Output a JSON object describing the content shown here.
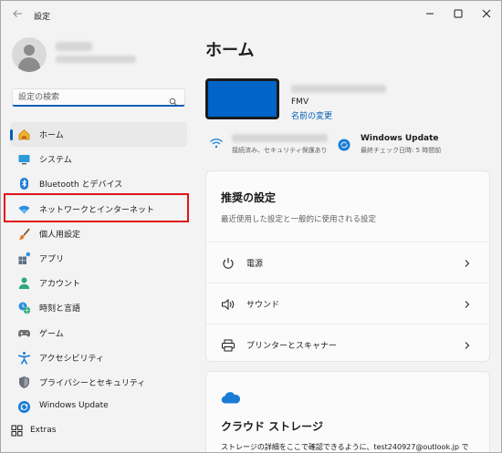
{
  "window": {
    "app_title": "設定",
    "back_icon": "back-arrow-icon",
    "controls": [
      "minimize-icon",
      "maximize-icon",
      "close-icon"
    ]
  },
  "sidebar": {
    "search": {
      "placeholder": "設定の検索",
      "value": ""
    },
    "items": [
      {
        "label": "ホーム",
        "icon": "home-icon",
        "selected": true
      },
      {
        "label": "システム",
        "icon": "system-icon"
      },
      {
        "label": "Bluetooth とデバイス",
        "icon": "bluetooth-icon"
      },
      {
        "label": "ネットワークとインターネット",
        "icon": "network-icon",
        "highlighted": true
      },
      {
        "label": "個人用設定",
        "icon": "brush-icon"
      },
      {
        "label": "アプリ",
        "icon": "apps-icon"
      },
      {
        "label": "アカウント",
        "icon": "account-icon"
      },
      {
        "label": "時刻と言語",
        "icon": "time-language-icon"
      },
      {
        "label": "ゲーム",
        "icon": "gamepad-icon"
      },
      {
        "label": "アクセシビリティ",
        "icon": "accessibility-icon"
      },
      {
        "label": "プライバシーとセキュリティ",
        "icon": "shield-icon"
      },
      {
        "label": "Windows Update",
        "icon": "windows-update-icon"
      }
    ],
    "extras": {
      "label": "Extras",
      "icon": "extras-icon"
    }
  },
  "main": {
    "title": "ホーム",
    "device": {
      "model": "FMV",
      "rename_link": "名前の変更"
    },
    "status": {
      "network_sub": "接続済み、セキュリティ保護あり",
      "update_title": "Windows Update",
      "update_sub": "最終チェック日時: 5 時間前"
    },
    "recommended": {
      "title": "推奨の設定",
      "subtitle": "最近使用した設定と一般的に使用される設定",
      "rows": [
        {
          "label": "電源",
          "icon": "power-icon"
        },
        {
          "label": "サウンド",
          "icon": "speaker-icon"
        },
        {
          "label": "プリンターとスキャナー",
          "icon": "printer-icon"
        }
      ]
    },
    "cloud": {
      "title": "クラウド ストレージ",
      "description": "ストレージの詳細をここで確認できるように、test240927@outlook.jp で"
    }
  },
  "colors": {
    "accent": "#005fb8",
    "highlight_border": "#e0121b",
    "device_screen": "#0164c8"
  }
}
